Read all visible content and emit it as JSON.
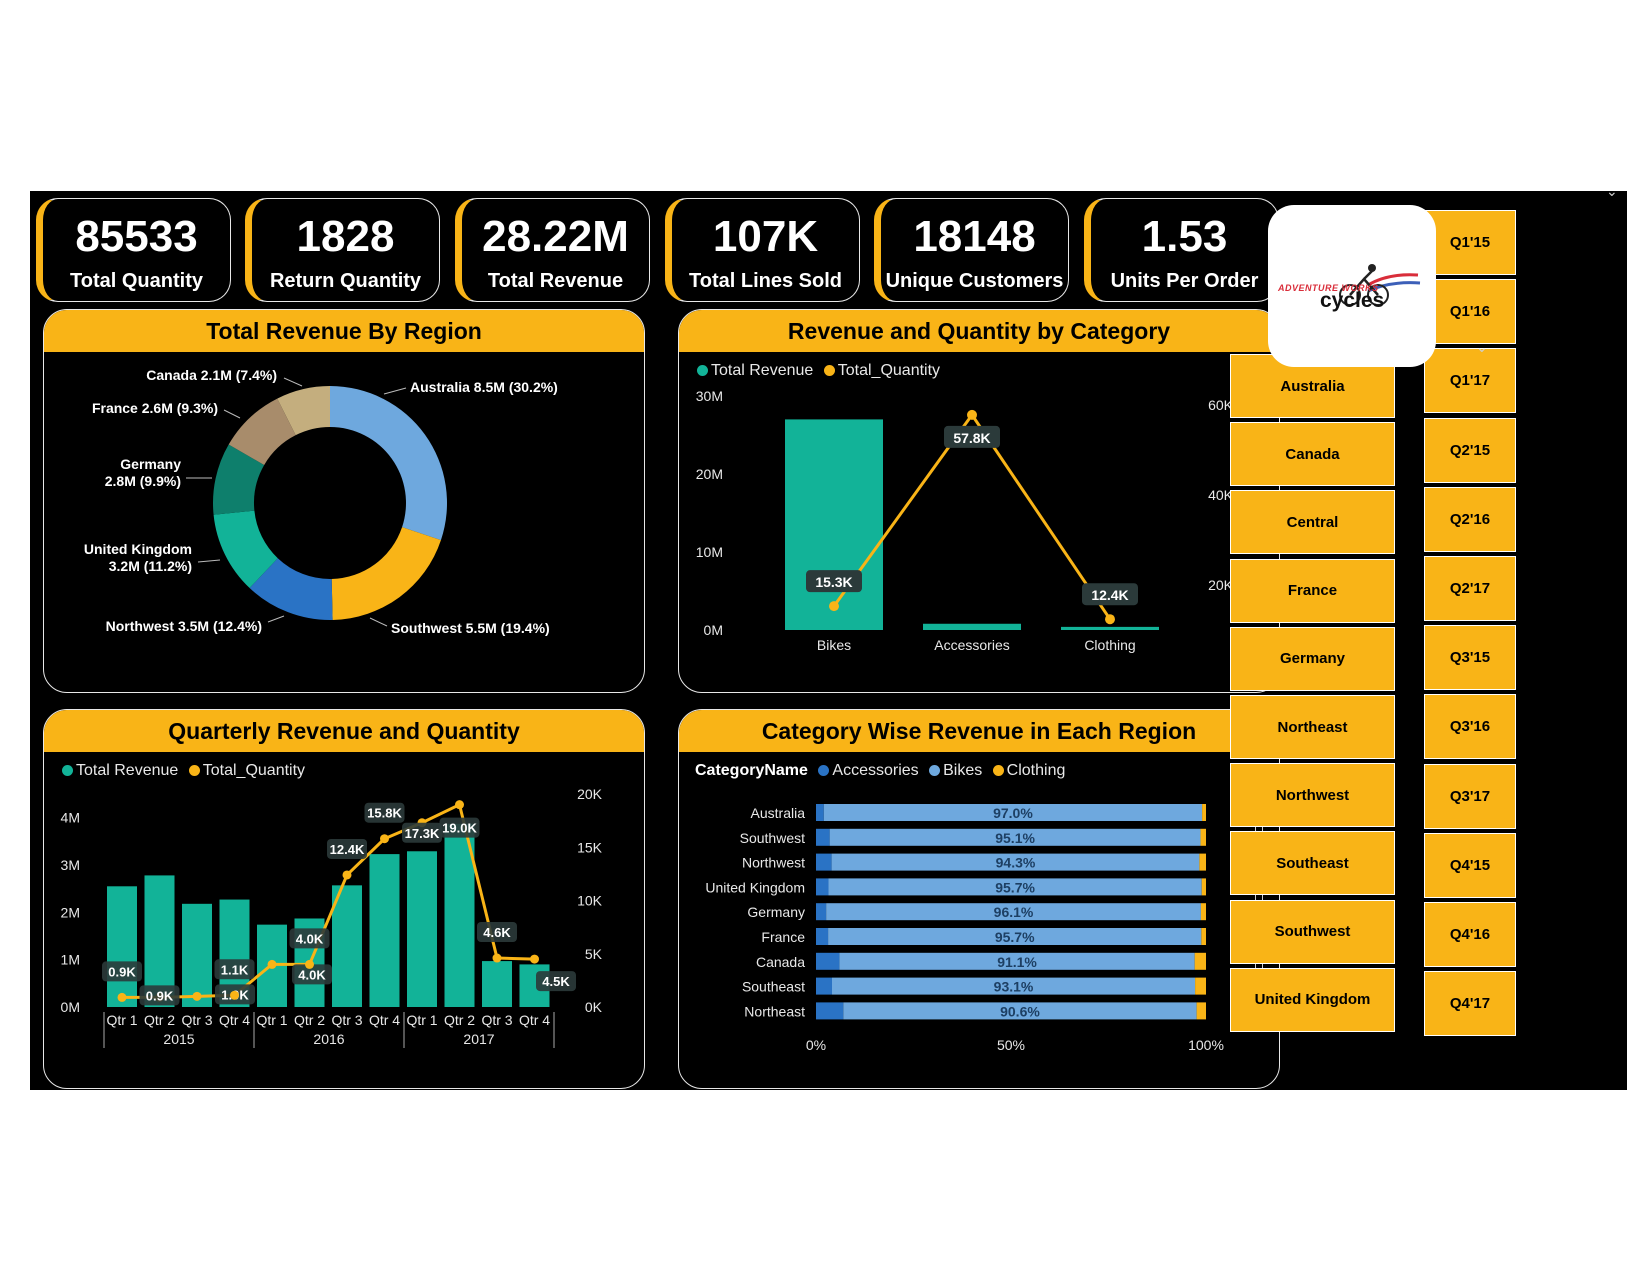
{
  "kpis": [
    {
      "value": "85533",
      "label": "Total Quantity"
    },
    {
      "value": "1828",
      "label": "Return Quantity"
    },
    {
      "value": "28.22M",
      "label": "Total Revenue"
    },
    {
      "value": "107K",
      "label": "Total Lines Sold"
    },
    {
      "value": "18148",
      "label": "Unique Customers"
    },
    {
      "value": "1.53",
      "label": "Units Per Order"
    }
  ],
  "logo": {
    "line1": "ADVENTURE WORKS",
    "line2": "cycles"
  },
  "colors": {
    "accent": "#F9B417",
    "teal": "#12B398",
    "bar_light": "#6EA8DE",
    "bar_dark": "#2A73C5",
    "line": "#F9B417"
  },
  "region_slicer": [
    "Australia",
    "Canada",
    "Central",
    "France",
    "Germany",
    "Northeast",
    "Northwest",
    "Southeast",
    "Southwest",
    "United Kingdom"
  ],
  "quarter_slicer": [
    "Q1'15",
    "Q1'16",
    "Q1'17",
    "Q2'15",
    "Q2'16",
    "Q2'17",
    "Q3'15",
    "Q3'16",
    "Q3'17",
    "Q4'15",
    "Q4'16",
    "Q4'17"
  ],
  "icons": {
    "slicer_dropdown": "chevron-down-icon"
  },
  "chart_data": [
    {
      "type": "pie",
      "title": "Total Revenue By Region",
      "slices": [
        {
          "name": "Australia",
          "value": 8.5,
          "label": "Australia 8.5M (30.2%)",
          "color": "#6EA8DE"
        },
        {
          "name": "Southwest",
          "value": 5.5,
          "label": "Southwest 5.5M (19.4%)",
          "color": "#F9B417"
        },
        {
          "name": "Northwest",
          "value": 3.5,
          "label": "Northwest 3.5M (12.4%)",
          "color": "#2A73C5"
        },
        {
          "name": "United Kingdom",
          "value": 3.2,
          "label_lines": [
            "United Kingdom",
            "3.2M (11.2%)"
          ],
          "color": "#12B398"
        },
        {
          "name": "Germany",
          "value": 2.8,
          "label_lines": [
            "Germany",
            "2.8M (9.9%)"
          ],
          "color": "#0E7F6C"
        },
        {
          "name": "France",
          "value": 2.6,
          "label": "France 2.6M (9.3%)",
          "color": "#A88C6B"
        },
        {
          "name": "Canada",
          "value": 2.1,
          "label": "Canada 2.1M (7.4%)",
          "color": "#C4AE7E"
        }
      ]
    },
    {
      "type": "bar",
      "title": "Revenue and Quantity by Category",
      "legend": [
        "Total Revenue",
        "Total_Quantity"
      ],
      "categories": [
        "Bikes",
        "Accessories",
        "Clothing"
      ],
      "series": [
        {
          "name": "Total Revenue",
          "type": "bar",
          "axis": "left",
          "values": [
            27000000,
            800000,
            400000
          ]
        },
        {
          "name": "Total_Quantity",
          "type": "line",
          "axis": "right",
          "values": [
            15300,
            57800,
            12400
          ],
          "data_labels": [
            "15.3K",
            "57.8K",
            "12.4K"
          ]
        }
      ],
      "y_left_ticks": [
        "0M",
        "10M",
        "20M",
        "30M"
      ],
      "ylim_left": [
        0,
        30000000
      ],
      "y_right_ticks": [
        "20K",
        "40K",
        "60K"
      ],
      "ylim_right": [
        10000,
        62000
      ]
    },
    {
      "type": "bar",
      "title": "Quarterly Revenue and Quantity",
      "legend": [
        "Total Revenue",
        "Total_Quantity"
      ],
      "categories": [
        "Qtr 1",
        "Qtr 2",
        "Qtr 3",
        "Qtr 4",
        "Qtr 1",
        "Qtr 2",
        "Qtr 3",
        "Qtr 4",
        "Qtr 1",
        "Qtr 2",
        "Qtr 3",
        "Qtr 4"
      ],
      "year_groups": [
        {
          "label": "2015",
          "span": 4
        },
        {
          "label": "2016",
          "span": 4
        },
        {
          "label": "2017",
          "span": 4
        }
      ],
      "series": [
        {
          "name": "Total Revenue",
          "type": "bar",
          "axis": "left",
          "values": [
            2550000,
            2780000,
            2180000,
            2270000,
            1740000,
            1870000,
            2570000,
            3230000,
            3290000,
            3870000,
            970000,
            900000
          ]
        },
        {
          "name": "Total_Quantity",
          "type": "line",
          "axis": "right",
          "values": [
            900,
            900,
            1000,
            1100,
            4000,
            4000,
            12400,
            15800,
            17300,
            19000,
            4600,
            4500
          ],
          "data_labels": [
            "0.9K",
            "0.9K",
            "1.0K",
            "1.1K",
            "4.0K",
            "4.0K",
            "12.4K",
            "15.8K",
            "17.3K",
            "19.0K",
            "4.6K",
            "4.5K"
          ]
        }
      ],
      "y_left_ticks": [
        "0M",
        "1M",
        "2M",
        "3M",
        "4M"
      ],
      "ylim_left": [
        0,
        4500000
      ],
      "y_right_ticks": [
        "0K",
        "5K",
        "10K",
        "15K",
        "20K"
      ],
      "ylim_right": [
        0,
        20000
      ]
    },
    {
      "type": "bar",
      "orientation": "horizontal-stacked-100",
      "title": "Category Wise Revenue in Each Region",
      "legend_title": "CategoryName",
      "legend": [
        "Accessories",
        "Bikes",
        "Clothing"
      ],
      "categories": [
        "Australia",
        "Southwest",
        "Northwest",
        "United Kingdom",
        "Germany",
        "France",
        "Canada",
        "Southeast",
        "Northeast"
      ],
      "series": [
        {
          "name": "Accessories",
          "values": [
            2.0,
            3.5,
            4.0,
            3.2,
            2.6,
            3.1,
            6.0,
            4.1,
            7.0
          ]
        },
        {
          "name": "Bikes",
          "values": [
            97.0,
            95.1,
            94.3,
            95.7,
            96.1,
            95.7,
            91.1,
            93.1,
            90.6
          ],
          "data_labels": [
            "97.0%",
            "95.1%",
            "94.3%",
            "95.7%",
            "96.1%",
            "95.7%",
            "91.1%",
            "93.1%",
            "90.6%"
          ]
        },
        {
          "name": "Clothing",
          "values": [
            1.0,
            1.4,
            1.7,
            1.1,
            1.3,
            1.2,
            2.9,
            2.8,
            2.4
          ]
        }
      ],
      "x_ticks": [
        "0%",
        "50%",
        "100%"
      ],
      "xlim": [
        0,
        100
      ]
    }
  ]
}
